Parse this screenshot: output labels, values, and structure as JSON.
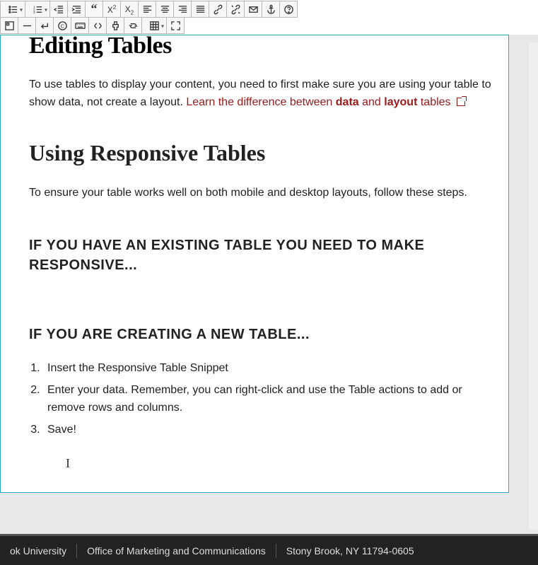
{
  "toolbar": {
    "row1": [
      {
        "name": "unordered-list",
        "icon": "ul",
        "dd": true
      },
      {
        "name": "ordered-list",
        "icon": "ol",
        "dd": true
      },
      {
        "name": "outdent",
        "icon": "outdent"
      },
      {
        "name": "indent",
        "icon": "indent"
      },
      {
        "name": "blockquote",
        "icon": "quote"
      },
      {
        "name": "superscript",
        "icon": "sup"
      },
      {
        "name": "subscript",
        "icon": "sub"
      },
      {
        "name": "align-left",
        "icon": "al"
      },
      {
        "name": "align-center",
        "icon": "ac"
      },
      {
        "name": "align-right",
        "icon": "ar"
      },
      {
        "name": "align-justify",
        "icon": "aj"
      },
      {
        "name": "link",
        "icon": "link"
      },
      {
        "name": "unlink",
        "icon": "unlink"
      },
      {
        "name": "email",
        "icon": "mail"
      },
      {
        "name": "anchor",
        "icon": "anchor"
      },
      {
        "name": "help",
        "icon": "help"
      }
    ],
    "row2": [
      {
        "name": "object",
        "icon": "obj"
      },
      {
        "name": "hr",
        "icon": "hr"
      },
      {
        "name": "return",
        "icon": "ret"
      },
      {
        "name": "copyright",
        "icon": "copy"
      },
      {
        "name": "keyboard",
        "icon": "kbd"
      },
      {
        "name": "code",
        "icon": "code"
      },
      {
        "name": "plugin",
        "icon": "plug"
      },
      {
        "name": "repeat",
        "icon": "rep"
      },
      {
        "name": "table",
        "icon": "tbl",
        "dd": true
      },
      {
        "name": "fullscreen",
        "icon": "full"
      }
    ]
  },
  "content": {
    "h1": "Editing Tables",
    "p1_a": "To use tables to display your content, you need to first make sure you are using your table to show data, not create a layout. ",
    "link_a": "Learn the difference between ",
    "link_b": "data",
    "link_c": " and ",
    "link_d": "layout",
    "link_e": " tables ",
    "h2": "Using Responsive Tables",
    "p2": "To ensure your table works well on both mobile and desktop layouts, follow these steps.",
    "h3a": "IF YOU HAVE AN EXISTING TABLE YOU NEED TO MAKE RESPONSIVE...",
    "h3b": "IF YOU ARE CREATING A NEW TABLE...",
    "steps": [
      "Insert the Responsive Table Snippet",
      "Enter your data. Remember, you can right-click and use the Table actions to add or remove rows and columns.",
      "Save!"
    ]
  },
  "footer": {
    "seg1": "ok University",
    "seg2": "Office of Marketing and Communications",
    "seg3": "Stony Brook, NY 11794-0605"
  }
}
